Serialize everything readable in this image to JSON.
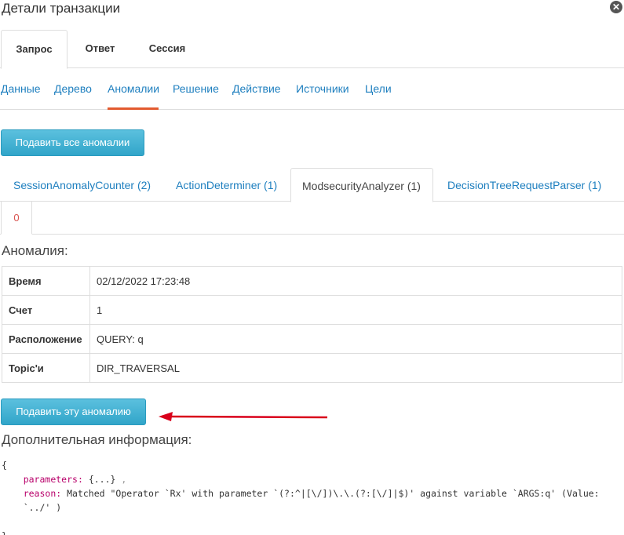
{
  "header": {
    "title": "Детали транзакции"
  },
  "top_tabs": [
    {
      "label": "Запрос",
      "active": true
    },
    {
      "label": "Ответ",
      "active": false
    },
    {
      "label": "Сессия",
      "active": false
    }
  ],
  "sub_nav": [
    {
      "label": "Данные"
    },
    {
      "label": "Дерево"
    },
    {
      "label": "Аномалии",
      "active": true
    },
    {
      "label": "Решение"
    },
    {
      "label": "Действие"
    },
    {
      "label": "Источники"
    },
    {
      "label": "Цели"
    }
  ],
  "buttons": {
    "submit_all": "Подавить все аномалии",
    "submit_one": "Подавить эту аномалию"
  },
  "analyzer_tabs": [
    {
      "label": "SessionAnomalyCounter (2)"
    },
    {
      "label": "ActionDeterminer (1)"
    },
    {
      "label": "ModsecurityAnalyzer (1)",
      "active": true
    },
    {
      "label": "DecisionTreeRequestParser (1)"
    }
  ],
  "index_tabs": [
    {
      "label": "0"
    }
  ],
  "anomaly": {
    "heading": "Аномалия:",
    "rows": [
      {
        "key": "Время",
        "value": "02/12/2022 17:23:48"
      },
      {
        "key": "Счет",
        "value": "1"
      },
      {
        "key": "Расположение",
        "value": "QUERY: q"
      },
      {
        "key": "Topic'и",
        "value": "DIR_TRAVERSAL"
      }
    ]
  },
  "extra": {
    "heading": "Дополнительная информация:",
    "open_brace": "{",
    "params_key": "parameters:",
    "params_value": "{...}",
    "comma": ",",
    "reason_key": "reason:",
    "reason_value": "Matched \"Operator `Rx' with parameter `(?:^|[\\/])\\.\\.(?:[\\/]|$)' against variable `ARGS:q' (Value:",
    "reason_cont": "`../' )",
    "close_brace": "}"
  },
  "colors": {
    "accent": "#5bc0de",
    "link": "#1e7fbf",
    "underline": "#e25a2f",
    "arrow": "#d9001b"
  },
  "icons": {
    "close": "close-icon"
  }
}
